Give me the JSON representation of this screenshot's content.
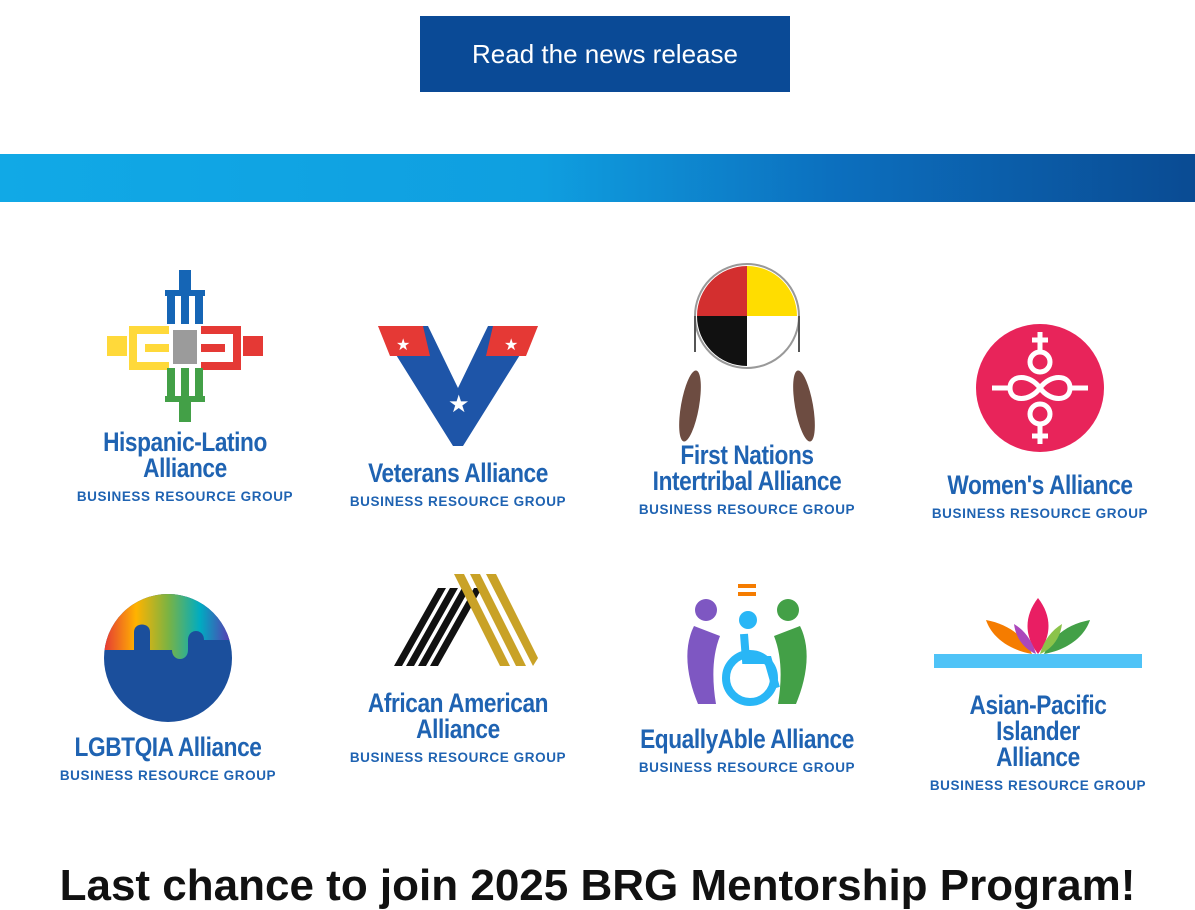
{
  "cta": {
    "label": "Read the news release"
  },
  "colors": {
    "cta": "#0a4a96",
    "brand_text": "#1f63b2",
    "band_start": "#11a9e6",
    "band_end": "#0a4b93"
  },
  "logos": [
    {
      "line1": "Hispanic-Latino",
      "line2": "Alliance",
      "sub": "BUSINESS RESOURCE GROUP",
      "icon": "hispanic-latino-emblem-icon"
    },
    {
      "line1": "Veterans Alliance",
      "line2": "",
      "sub": "BUSINESS RESOURCE GROUP",
      "icon": "veterans-eagle-icon"
    },
    {
      "line1": "First Nations",
      "line2": "Intertribal Alliance",
      "sub": "BUSINESS RESOURCE GROUP",
      "icon": "medicine-wheel-icon"
    },
    {
      "line1": "Women's Alliance",
      "line2": "",
      "sub": "BUSINESS RESOURCE GROUP",
      "icon": "women-symbol-icon"
    },
    {
      "line1": "LGBTQIA Alliance",
      "line2": "",
      "sub": "BUSINESS RESOURCE GROUP",
      "icon": "rainbow-puzzle-icon"
    },
    {
      "line1": "African American",
      "line2": "Alliance",
      "sub": "BUSINESS RESOURCE GROUP",
      "icon": "striped-a-icon"
    },
    {
      "line1": "EquallyAble Alliance",
      "line2": "",
      "sub": "BUSINESS RESOURCE GROUP",
      "icon": "accessibility-figures-icon"
    },
    {
      "line1": "Asian-Pacific Islander",
      "line2": "Alliance",
      "sub": "BUSINESS RESOURCE GROUP",
      "icon": "lotus-icon"
    }
  ],
  "headline": "Last chance to join 2025 BRG Mentorship Program!"
}
